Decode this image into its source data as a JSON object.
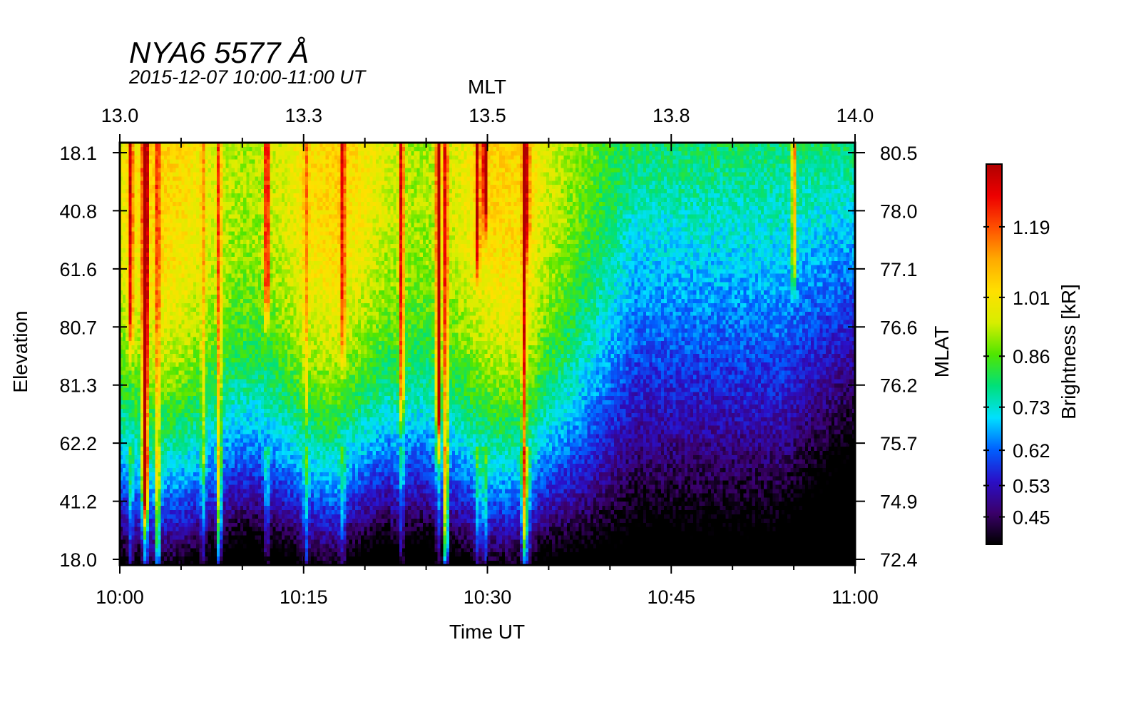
{
  "chart_data": {
    "type": "heatmap",
    "title": "NYA6 5577 Å",
    "subtitle": "2015-12-07 10:00-11:00 UT",
    "xlabel": "Time UT",
    "ylabel": "Elevation",
    "top_xlabel": "MLT",
    "right_ylabel": "MLAT",
    "colorbar_label": "Brightness [kR]",
    "x_ticks": [
      "10:00",
      "10:15",
      "10:30",
      "10:45",
      "11:00"
    ],
    "top_ticks": [
      "13.0",
      "13.3",
      "13.5",
      "13.8",
      "14.0"
    ],
    "y_ticks_left": [
      "18.1",
      "40.8",
      "61.6",
      "80.7",
      "81.3",
      "62.2",
      "41.2",
      "18.0"
    ],
    "y_ticks_right": [
      "80.5",
      "78.0",
      "77.1",
      "76.6",
      "76.2",
      "75.7",
      "74.9",
      "72.4"
    ],
    "colorbar_ticks": [
      "1.19",
      "1.01",
      "0.86",
      "0.73",
      "0.62",
      "0.53",
      "0.45"
    ],
    "xlim_minutes": [
      0,
      60
    ],
    "colorbar_range": [
      0.38,
      1.35
    ],
    "colormap": [
      "#000000",
      "#3b006b",
      "#2a10c8",
      "#0060ff",
      "#00e0ff",
      "#00e07a",
      "#50e600",
      "#d8ee00",
      "#ffe000",
      "#ffaa00",
      "#ff5000",
      "#ee0000",
      "#b00000"
    ],
    "grid": false
  }
}
